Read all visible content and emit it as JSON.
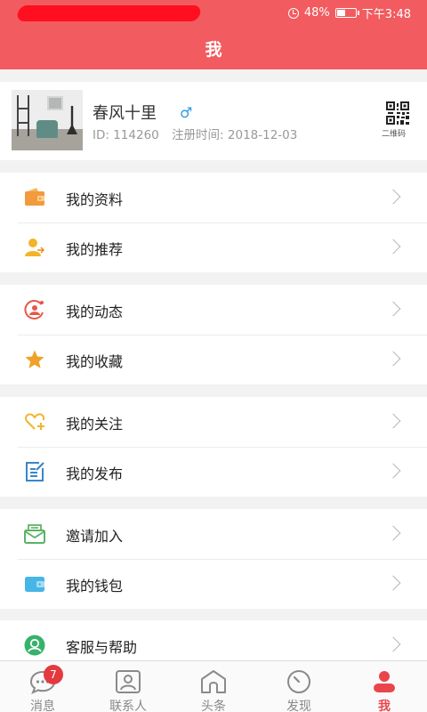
{
  "status_bar": {
    "battery": "48%",
    "time": "下午3:48"
  },
  "header": {
    "title": "我"
  },
  "profile": {
    "nickname": "春风十里",
    "gender_symbol": "♂",
    "id_text": "ID: 114260",
    "register_text": "注册时间: 2018-12-03",
    "qr_label": "二维码"
  },
  "menu_groups": [
    {
      "items": [
        {
          "label": "我的资料",
          "icon": "wallet-card-icon"
        },
        {
          "label": "我的推荐",
          "icon": "user-share-icon"
        }
      ]
    },
    {
      "items": [
        {
          "label": "我的动态",
          "icon": "activity-icon"
        },
        {
          "label": "我的收藏",
          "icon": "star-icon"
        }
      ]
    },
    {
      "items": [
        {
          "label": "我的关注",
          "icon": "heart-plus-icon"
        },
        {
          "label": "我的发布",
          "icon": "edit-icon"
        }
      ]
    },
    {
      "items": [
        {
          "label": "邀请加入",
          "icon": "invite-mail-icon"
        },
        {
          "label": "我的钱包",
          "icon": "wallet-icon"
        }
      ]
    },
    {
      "items": [
        {
          "label": "客服与帮助",
          "icon": "customer-service-icon"
        }
      ]
    }
  ],
  "tabs": [
    {
      "label": "消息",
      "icon": "chat-icon",
      "badge": "7"
    },
    {
      "label": "联系人",
      "icon": "contacts-icon"
    },
    {
      "label": "头条",
      "icon": "home-icon"
    },
    {
      "label": "发现",
      "icon": "compass-icon"
    },
    {
      "label": "我",
      "icon": "person-icon",
      "active": true
    }
  ],
  "colors": {
    "header": "#f25b5f",
    "accent": "#e9464b",
    "badge": "#e23a3f"
  }
}
